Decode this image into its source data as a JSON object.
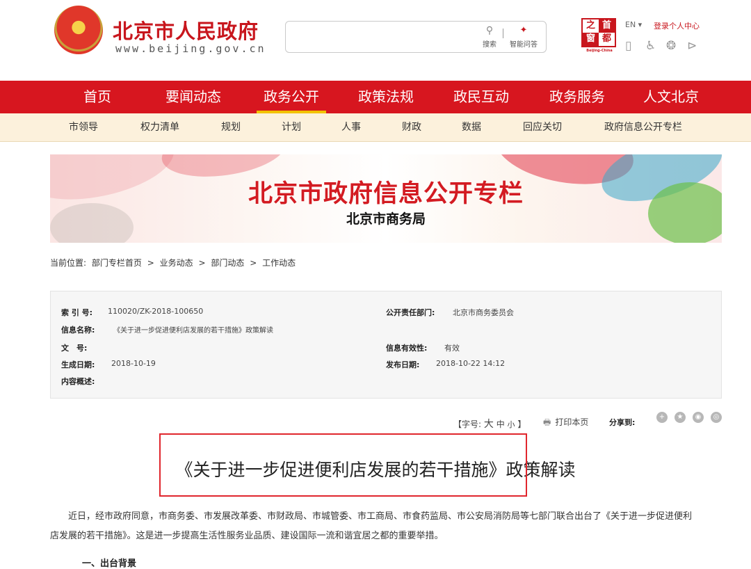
{
  "header": {
    "title": "北京市人民政府",
    "subtitle": "www.beijing.gov.cn",
    "search_placeholder": "",
    "search_label": "搜索",
    "qa_label": "智能问答",
    "capital_chars": [
      "之",
      "首",
      "窗",
      "都"
    ],
    "capital_caption": "Beijing-China",
    "lang": "EN ▾",
    "login": "登录个人中心"
  },
  "nav": {
    "items": [
      "首页",
      "要闻动态",
      "政务公开",
      "政策法规",
      "政民互动",
      "政务服务",
      "人文北京"
    ],
    "active_index": 2
  },
  "subnav": {
    "items": [
      "市领导",
      "权力清单",
      "规划",
      "计划",
      "人事",
      "财政",
      "数据",
      "回应关切",
      "政府信息公开专栏"
    ]
  },
  "banner": {
    "title": "北京市政府信息公开专栏",
    "subtitle": "北京市商务局"
  },
  "breadcrumb": {
    "prefix": "当前位置:",
    "items": [
      "部门专栏首页",
      ">",
      "业务动态",
      ">",
      "部门动态",
      ">",
      "工作动态"
    ]
  },
  "info": {
    "index_label": "索 引 号:",
    "index_value": "110020/ZK-2018-100650",
    "dept_label": "公开责任部门:",
    "dept_value": "北京市商务委员会",
    "name_label": "信息名称:",
    "name_value": "《关于进一步促进便利店发展的若干措施》政策解读",
    "doc_label": "文　号:",
    "doc_value": "",
    "valid_label": "信息有效性:",
    "valid_value": "有效",
    "created_label": "生成日期:",
    "created_value": "2018-10-19",
    "published_label": "发布日期:",
    "published_value": "2018-10-22 14:12",
    "summary_label": "内容概述:",
    "summary_value": ""
  },
  "toolbar": {
    "font_prefix": "【字号:",
    "font_large": "大",
    "font_medium": "中",
    "font_small": "小",
    "font_suffix": "】",
    "print": "打印本页",
    "share": "分享到:"
  },
  "article": {
    "title_highlighted": "《关于进一步促进便利店发展的若干措施》",
    "title_rest": "政策解读",
    "para1_line1": "近日，经市政府同意，市商务委、市发展改革委、市财政局、市城管委、市工商局、市食药监局、市公安局消防局等七部门联合出台了《关于进一步促进便利",
    "para1_line2": "店发展的若干措施》。这是进一步提高生活性服务业品质、建设国际一流和谐宜居之都的重要举措。",
    "heading_cut": "一、出台背景"
  },
  "colors": {
    "brand_red": "#d7161f",
    "active_tab_underline": "#f2c200",
    "subnav_bg": "#fcf1dc",
    "highlight_border": "#e0262d"
  }
}
